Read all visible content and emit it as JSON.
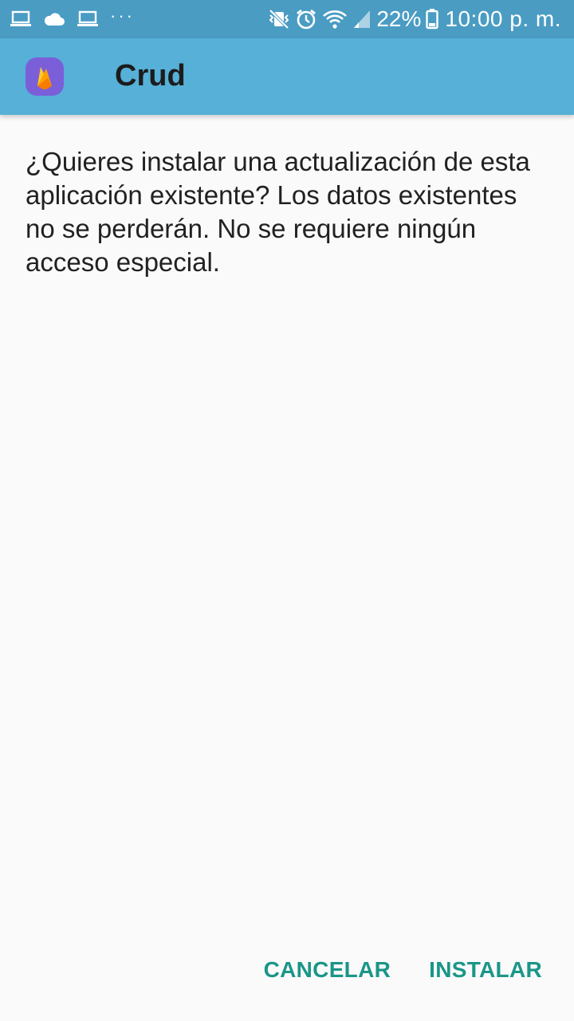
{
  "status_bar": {
    "icons_left": [
      "laptop-icon",
      "cloud-icon",
      "laptop-icon",
      "more-dots-icon"
    ],
    "icons_right": [
      "vibrate-mute-icon",
      "alarm-icon",
      "wifi-icon",
      "signal-icon",
      "battery-icon"
    ],
    "dots": "···",
    "battery": "22%",
    "time": "10:00 p. m."
  },
  "app_bar": {
    "icon": "firebase-app-icon",
    "title": "Crud"
  },
  "message": {
    "text": "¿Quieres instalar una actualización de esta aplicación existente? Los datos existentes no se perderán. No se requiere ningún acceso especial."
  },
  "actions": {
    "cancel_label": "CANCELAR",
    "install_label": "INSTALAR"
  },
  "colors": {
    "status_bar": "#4a9cc3",
    "app_bar": "#56b0d7",
    "accent": "#1a9688",
    "app_icon_bg": "#7b5fd9",
    "background": "#fafafa"
  }
}
